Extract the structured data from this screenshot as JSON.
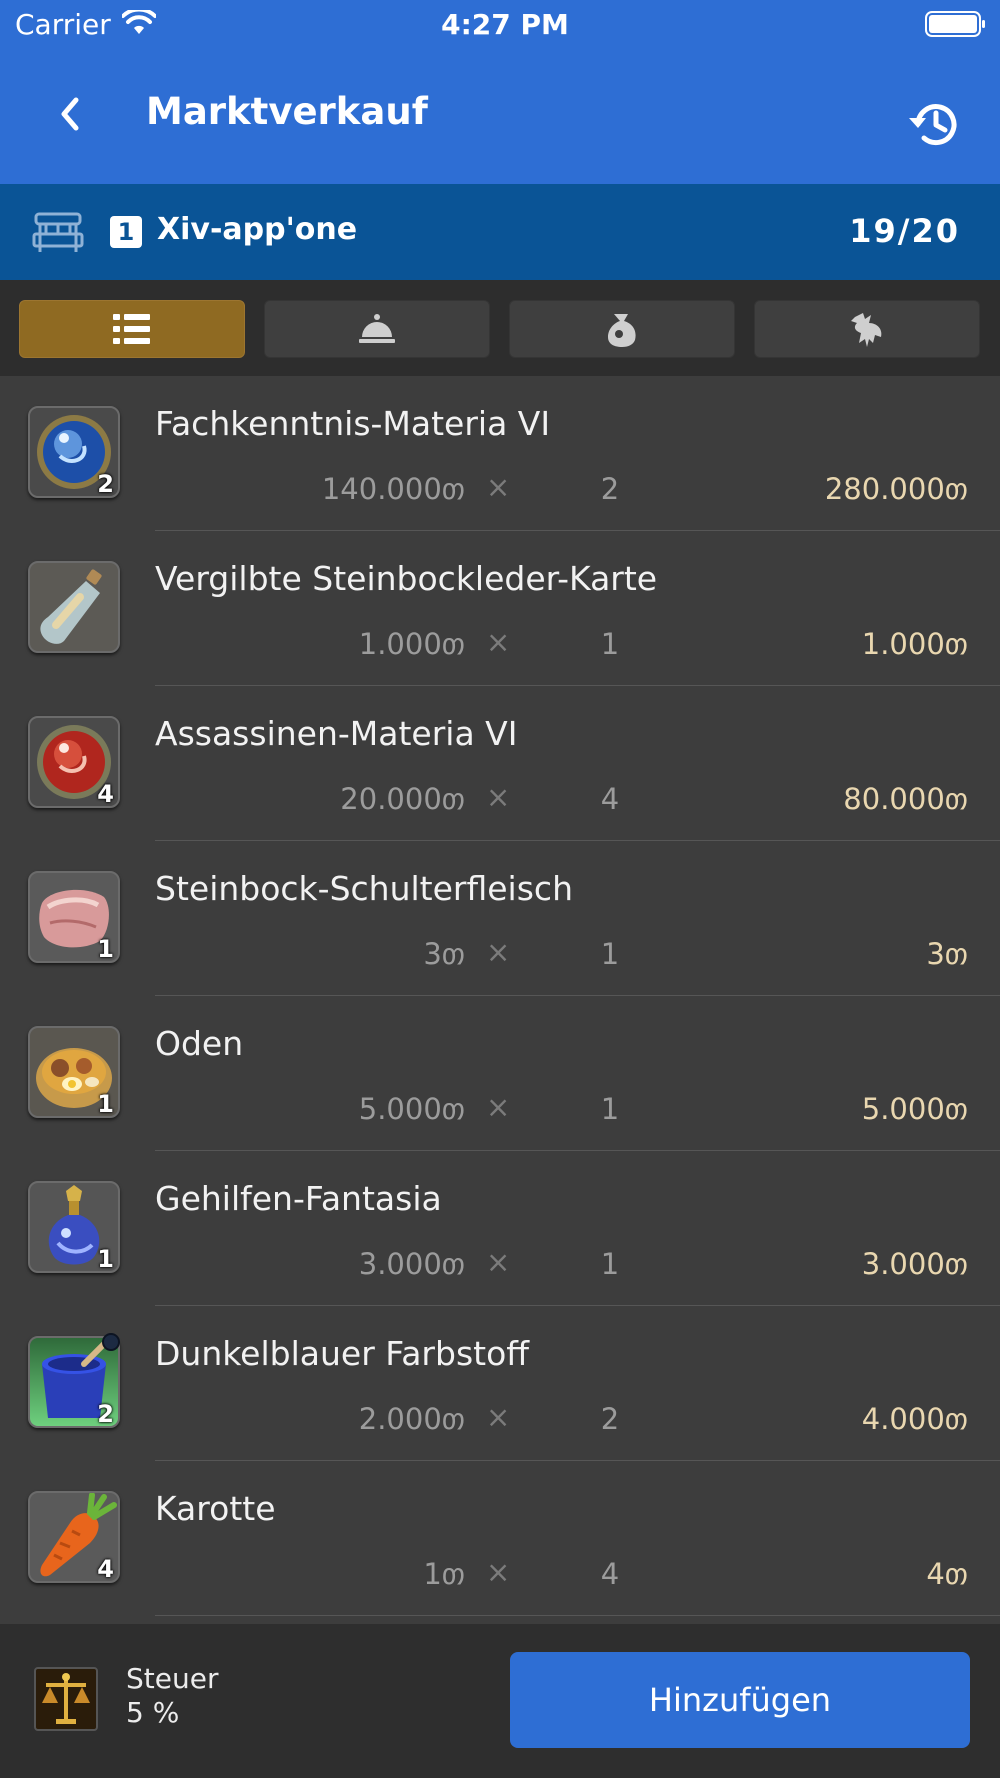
{
  "status_bar": {
    "carrier": "Carrier",
    "time": "4:27 PM"
  },
  "nav": {
    "title": "Marktverkauf",
    "back_icon": "chevron-left-icon",
    "history_icon": "history-icon"
  },
  "retainer": {
    "slot": "1",
    "name": "Xiv-app'one",
    "count": "19/20"
  },
  "tabs": [
    {
      "icon": "list-icon",
      "active": true
    },
    {
      "icon": "service-bell-icon",
      "active": false
    },
    {
      "icon": "bag-icon",
      "active": false
    },
    {
      "icon": "chocobo-icon",
      "active": false
    }
  ],
  "items": [
    {
      "name": "Fachkenntnis-Materia VI",
      "icon": "blue-materia-icon",
      "stack": "2",
      "unit_price": "140.000თ",
      "times": "×",
      "quantity": "2",
      "total": "280.000თ"
    },
    {
      "name": "Vergilbte Steinbockleder-Karte",
      "icon": "bottle-map-icon",
      "stack": "",
      "unit_price": "1.000თ",
      "times": "×",
      "quantity": "1",
      "total": "1.000თ"
    },
    {
      "name": "Assassinen-Materia VI",
      "icon": "red-materia-icon",
      "stack": "4",
      "unit_price": "20.000თ",
      "times": "×",
      "quantity": "4",
      "total": "80.000თ"
    },
    {
      "name": "Steinbock-Schulterfleisch",
      "icon": "meat-icon",
      "stack": "1",
      "unit_price": "3თ",
      "times": "×",
      "quantity": "1",
      "total": "3თ"
    },
    {
      "name": "Oden",
      "icon": "oden-bowl-icon",
      "stack": "1",
      "unit_price": "5.000თ",
      "times": "×",
      "quantity": "1",
      "total": "5.000თ"
    },
    {
      "name": "Gehilfen-Fantasia",
      "icon": "potion-flask-icon",
      "stack": "1",
      "unit_price": "3.000თ",
      "times": "×",
      "quantity": "1",
      "total": "3.000თ"
    },
    {
      "name": "Dunkelblauer Farbstoff",
      "icon": "dye-pot-icon",
      "stack": "2",
      "unit_price": "2.000თ",
      "times": "×",
      "quantity": "2",
      "total": "4.000თ",
      "hq": true
    },
    {
      "name": "Karotte",
      "icon": "carrot-icon",
      "stack": "4",
      "unit_price": "1თ",
      "times": "×",
      "quantity": "4",
      "total": "4თ"
    }
  ],
  "footer": {
    "tax_label": "Steuer",
    "tax_value": "5 %",
    "add_label": "Hinzufügen",
    "tax_icon": "scales-icon"
  },
  "colors": {
    "accent": "#2e6ed4",
    "retainer_bar": "#0a5496",
    "active_tab": "#8f6a22",
    "total_text": "#e9d7b0"
  }
}
